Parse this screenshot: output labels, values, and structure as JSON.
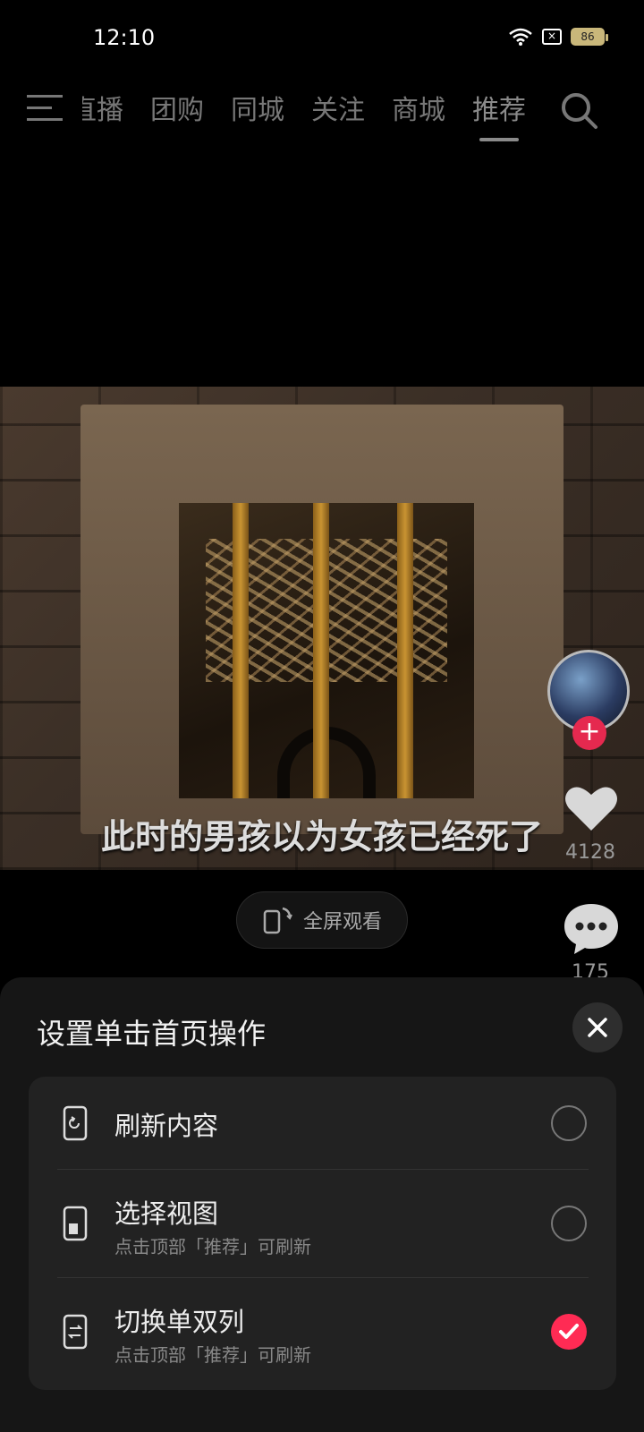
{
  "status_bar": {
    "time": "12:10",
    "battery": "86"
  },
  "nav": {
    "tabs": [
      {
        "label": "直播",
        "partial": true
      },
      {
        "label": "团购"
      },
      {
        "label": "同城"
      },
      {
        "label": "关注"
      },
      {
        "label": "商城"
      },
      {
        "label": "推荐",
        "active": true
      }
    ]
  },
  "video": {
    "subtitle": "此时的男孩以为女孩已经死了"
  },
  "actions": {
    "likes": "4128",
    "comments": "175",
    "fullscreen_label": "全屏观看"
  },
  "sheet": {
    "title": "设置单击首页操作",
    "options": [
      {
        "label": "刷新内容",
        "sub": "",
        "icon": "refresh-phone-icon",
        "selected": false
      },
      {
        "label": "选择视图",
        "sub": "点击顶部「推荐」可刷新",
        "icon": "view-phone-icon",
        "selected": false
      },
      {
        "label": "切换单双列",
        "sub": "点击顶部「推荐」可刷新",
        "icon": "switch-phone-icon",
        "selected": true
      }
    ]
  },
  "colors": {
    "accent": "#ff2b54",
    "sheet_bg": "#161616",
    "card_bg": "#222222"
  }
}
